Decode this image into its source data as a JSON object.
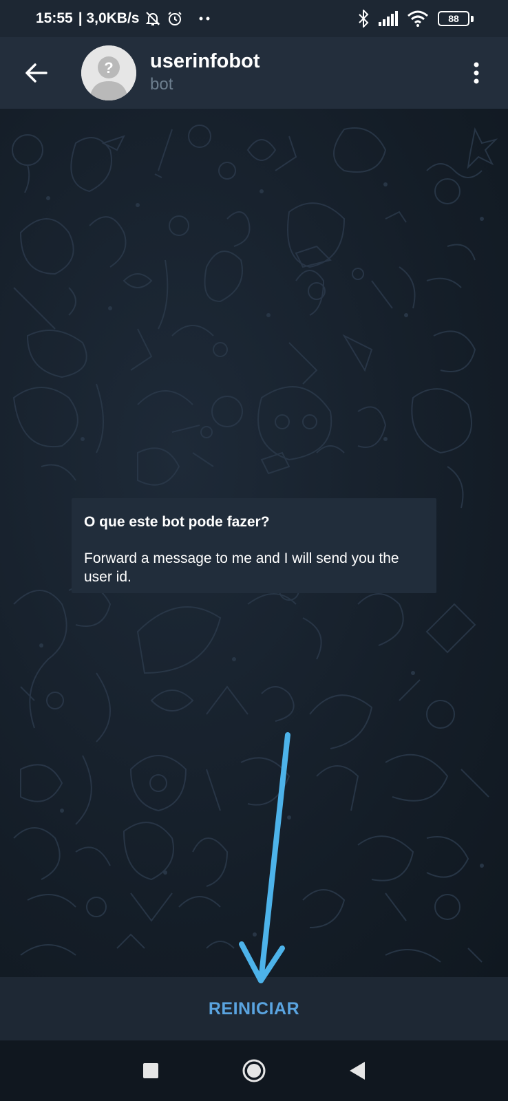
{
  "status_bar": {
    "time": "15:55",
    "network_speed": "| 3,0KB/s",
    "battery": "88",
    "icons": [
      "alarm-off-icon",
      "alarm-clock-icon",
      "dots-icon",
      "bluetooth-icon",
      "signal-icon",
      "wifi-icon",
      "battery-icon"
    ]
  },
  "header": {
    "title": "userinfobot",
    "subtitle": "bot"
  },
  "info_card": {
    "title": "O que este bot pode fazer?",
    "text": "Forward a message to me and I will send you the user id."
  },
  "bottom": {
    "restart_label": "REINICIAR"
  },
  "colors": {
    "app_bar": "#232e3c",
    "chat_background": "#17212b",
    "accent": "#5aa4e0",
    "annotation_arrow": "#4db3ea"
  }
}
